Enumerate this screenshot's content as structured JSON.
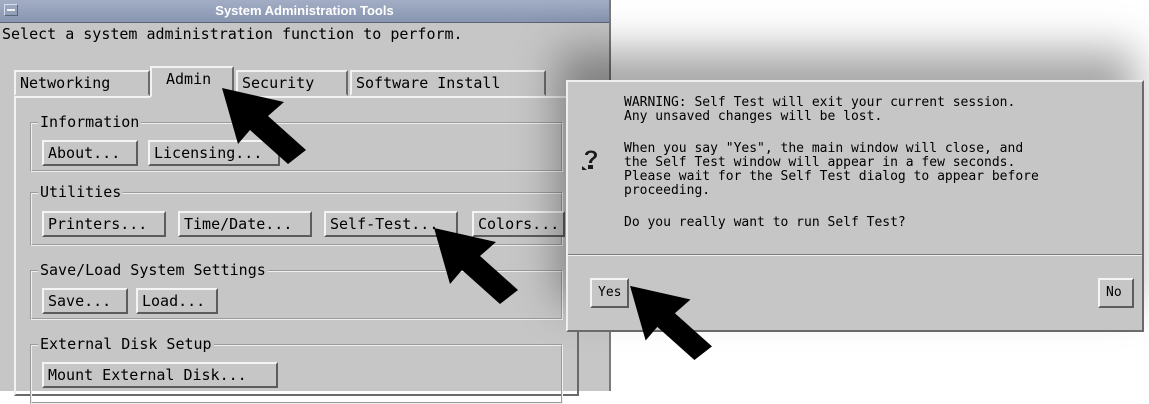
{
  "window": {
    "title": "System Administration Tools",
    "prompt": "Select a system administration function to perform."
  },
  "tabs": [
    {
      "label": "Networking",
      "active": false
    },
    {
      "label": "Admin",
      "active": true
    },
    {
      "label": "Security",
      "active": false
    },
    {
      "label": "Software Install",
      "active": false
    }
  ],
  "groups": {
    "information": {
      "title": "Information",
      "buttons": [
        "About...",
        "Licensing..."
      ]
    },
    "utilities": {
      "title": "Utilities",
      "buttons": [
        "Printers...",
        "Time/Date...",
        "Self-Test...",
        "Colors..."
      ]
    },
    "save_load": {
      "title": "Save/Load System Settings",
      "buttons": [
        "Save...",
        "Load..."
      ]
    },
    "external_disk": {
      "title": "External Disk Setup",
      "buttons": [
        "Mount External Disk..."
      ]
    }
  },
  "dialog": {
    "icon": "question-icon",
    "lines": [
      "WARNING: Self Test will exit your current session.",
      "Any unsaved changes will be lost.",
      "When you say \"Yes\", the main window will close, and",
      "the Self Test window will appear in a few seconds.",
      "Please wait for the Self Test dialog to appear before",
      "proceeding.",
      "Do you really want to run Self Test?"
    ],
    "yes_label": "Yes",
    "no_label": "No"
  }
}
